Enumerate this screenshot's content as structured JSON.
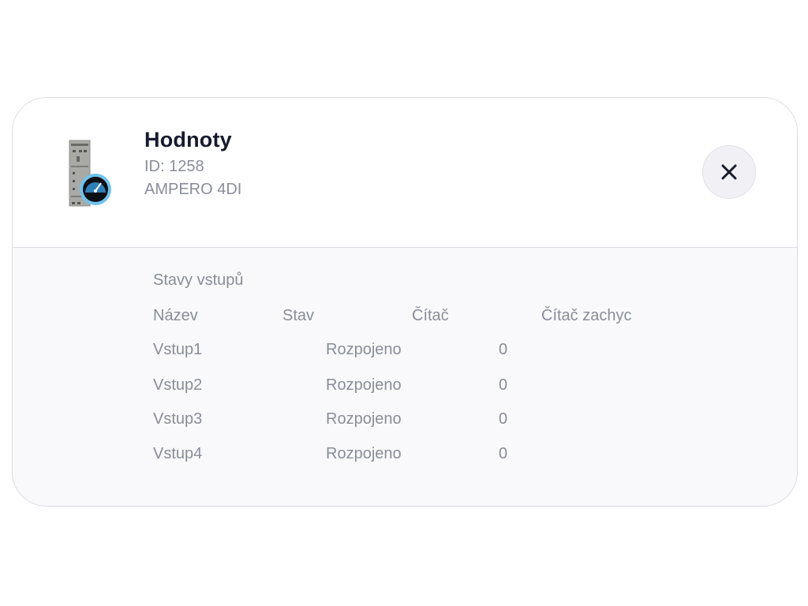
{
  "header": {
    "title": "Hodnoty",
    "id_line": "ID: 1258",
    "model": "AMPERO 4DI",
    "device_icon": "din-rail-module-with-gauge-icon",
    "close_icon": "close-icon"
  },
  "inputs": {
    "section_title": "Stavy vstupů",
    "columns": [
      "Název",
      "Stav",
      "Čítač",
      "Čítač zachyc"
    ],
    "rows": [
      {
        "name": "Vstup1",
        "state": "Rozpojeno",
        "counter": "0"
      },
      {
        "name": "Vstup2",
        "state": "Rozpojeno",
        "counter": "0"
      },
      {
        "name": "Vstup3",
        "state": "Rozpojeno",
        "counter": "0"
      },
      {
        "name": "Vstup4",
        "state": "Rozpojeno",
        "counter": "0"
      }
    ]
  },
  "colors": {
    "title": "#171b2c",
    "muted_text": "#8a8d99",
    "gauge_ring": "#6ec3f0"
  }
}
